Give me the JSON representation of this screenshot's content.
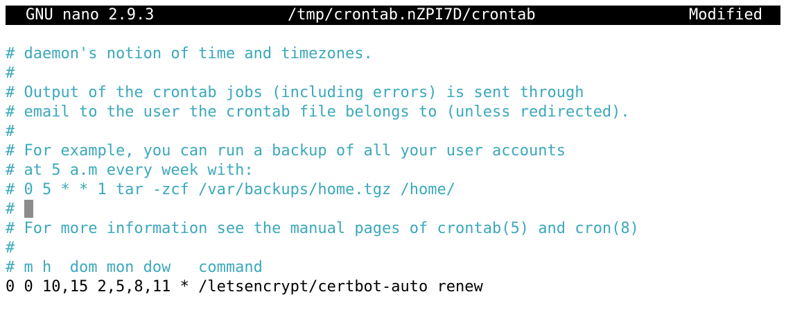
{
  "titlebar": {
    "app": "GNU nano 2.9.3",
    "file": "/tmp/crontab.nZPI7D/crontab",
    "status": "Modified"
  },
  "editor": {
    "lines": [
      "# daemon's notion of time and timezones.",
      "#",
      "# Output of the crontab jobs (including errors) is sent through",
      "# email to the user the crontab file belongs to (unless redirected).",
      "#",
      "# For example, you can run a backup of all your user accounts",
      "# at 5 a.m every week with:",
      "# 0 5 * * 1 tar -zcf /var/backups/home.tgz /home/",
      "# ",
      "# For more information see the manual pages of crontab(5) and cron(8)",
      "#",
      "# m h  dom mon dow   command",
      "0 0 10,15 2,5,8,11 * /letsencrypt/certbot-auto renew"
    ]
  },
  "colors": {
    "comment": "#3ca8bb",
    "code": "#000000",
    "titlebar_bg": "#000000",
    "cursor": "#8c8c8c"
  }
}
